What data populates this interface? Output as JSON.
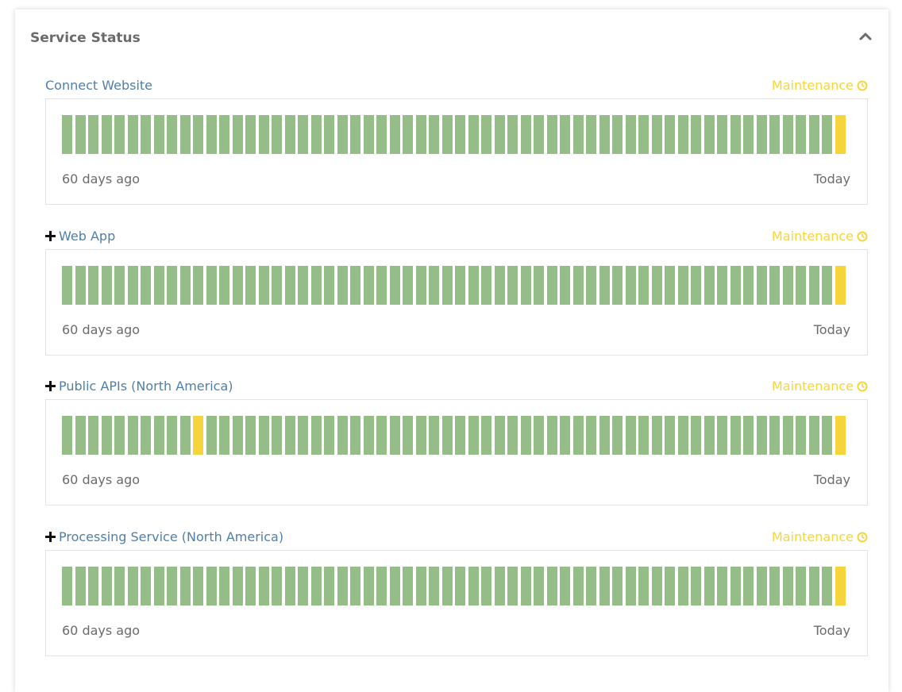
{
  "panel": {
    "title": "Service Status"
  },
  "services": [
    {
      "name": "Connect Website",
      "expandable": false,
      "status": "Maintenance",
      "history_days": 60,
      "maintenance_days": [
        60
      ],
      "left_label": "60 days ago",
      "right_label": "Today"
    },
    {
      "name": "Web App",
      "expandable": true,
      "status": "Maintenance",
      "history_days": 60,
      "maintenance_days": [
        60
      ],
      "left_label": "60 days ago",
      "right_label": "Today"
    },
    {
      "name": "Public APIs (North America)",
      "expandable": true,
      "status": "Maintenance",
      "history_days": 60,
      "maintenance_days": [
        11,
        60
      ],
      "left_label": "60 days ago",
      "right_label": "Today"
    },
    {
      "name": "Processing Service (North America)",
      "expandable": true,
      "status": "Maintenance",
      "history_days": 60,
      "maintenance_days": [
        60
      ],
      "left_label": "60 days ago",
      "right_label": "Today"
    }
  ],
  "colors": {
    "operational": "#94bd88",
    "maintenance": "#f6d53c",
    "link": "#4f7fa8",
    "muted_text": "#6b6b6b"
  },
  "icons": {
    "collapse": "chevron-up-icon",
    "status": "clock-icon",
    "expand": "plus-icon"
  }
}
